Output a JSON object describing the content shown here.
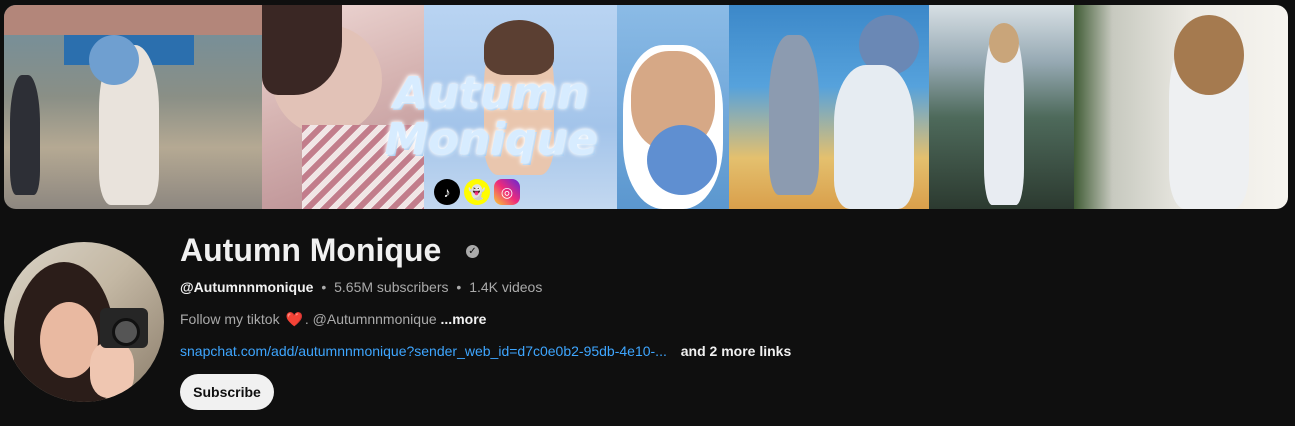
{
  "banner": {
    "title_line1": "Autumn",
    "title_line2": "Monique",
    "social_icons": [
      "tiktok-icon",
      "snapchat-icon",
      "instagram-icon"
    ]
  },
  "channel": {
    "name": "Autumn Monique",
    "verified_icon": "verified-check-icon",
    "handle": "@Autumnnmonique",
    "subscribers": "5.65M subscribers",
    "videos": "1.4K videos",
    "separator": "•",
    "about_text": "Follow my tiktok",
    "about_emoji": "❤️",
    "about_suffix": ".  @Autumnnmonique",
    "about_more": "...more",
    "link_text": "snapchat.com/add/autumnnmonique?sender_web_id=d7c0e0b2-95db-4e10-...",
    "more_links": "and 2 more links",
    "subscribe_label": "Subscribe"
  },
  "colors": {
    "background": "#0f0f0f",
    "text_primary": "#f1f1f1",
    "text_secondary": "#aaaaaa",
    "link": "#3ea6ff",
    "subscribe_bg": "#f1f1f1"
  }
}
